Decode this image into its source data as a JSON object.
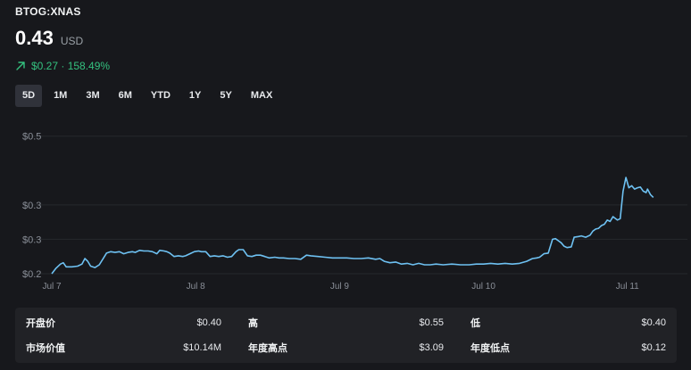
{
  "header": {
    "ticker": "BTOG:XNAS",
    "price": "0.43",
    "currency": "USD",
    "change_text": "$0.27 · 158.49%",
    "change_direction": "up",
    "positive_color": "#34c17f"
  },
  "ranges": {
    "options": [
      "5D",
      "1M",
      "3M",
      "6M",
      "YTD",
      "1Y",
      "5Y",
      "MAX"
    ],
    "selected": "5D"
  },
  "chart_data": {
    "type": "line",
    "line_color": "#6ec1f2",
    "grid": true,
    "legend": "none",
    "x_labels": [
      "Jul 7",
      "Jul 8",
      "Jul 9",
      "Jul 10",
      "Jul 11"
    ],
    "y_ticks": [
      {
        "value": 0.2,
        "label": "$0.2"
      },
      {
        "value": 0.25,
        "label": "$0.3"
      },
      {
        "value": 0.3,
        "label": "$0.3"
      },
      {
        "value": 0.4,
        "label": "$0.5"
      }
    ],
    "ylim": [
      0.2,
      0.41
    ],
    "xlim": [
      0,
      4.2
    ],
    "points": [
      [
        0.0,
        0.2
      ],
      [
        0.03,
        0.208
      ],
      [
        0.06,
        0.214
      ],
      [
        0.08,
        0.216
      ],
      [
        0.1,
        0.21
      ],
      [
        0.14,
        0.21
      ],
      [
        0.18,
        0.211
      ],
      [
        0.21,
        0.214
      ],
      [
        0.23,
        0.222
      ],
      [
        0.25,
        0.218
      ],
      [
        0.27,
        0.211
      ],
      [
        0.3,
        0.209
      ],
      [
        0.33,
        0.213
      ],
      [
        0.36,
        0.223
      ],
      [
        0.38,
        0.23
      ],
      [
        0.41,
        0.232
      ],
      [
        0.44,
        0.231
      ],
      [
        0.47,
        0.232
      ],
      [
        0.5,
        0.229
      ],
      [
        0.53,
        0.231
      ],
      [
        0.56,
        0.232
      ],
      [
        0.58,
        0.231
      ],
      [
        0.61,
        0.234
      ],
      [
        0.64,
        0.233
      ],
      [
        0.67,
        0.233
      ],
      [
        0.7,
        0.232
      ],
      [
        0.73,
        0.229
      ],
      [
        0.75,
        0.234
      ],
      [
        0.78,
        0.233
      ],
      [
        0.8,
        0.232
      ],
      [
        0.82,
        0.23
      ],
      [
        0.85,
        0.225
      ],
      [
        0.88,
        0.226
      ],
      [
        0.91,
        0.225
      ],
      [
        0.93,
        0.226
      ],
      [
        0.96,
        0.229
      ],
      [
        0.99,
        0.232
      ],
      [
        1.02,
        0.233
      ],
      [
        1.04,
        0.232
      ],
      [
        1.07,
        0.232
      ],
      [
        1.1,
        0.225
      ],
      [
        1.13,
        0.226
      ],
      [
        1.16,
        0.225
      ],
      [
        1.19,
        0.226
      ],
      [
        1.22,
        0.224
      ],
      [
        1.25,
        0.225
      ],
      [
        1.28,
        0.232
      ],
      [
        1.3,
        0.235
      ],
      [
        1.33,
        0.235
      ],
      [
        1.36,
        0.226
      ],
      [
        1.39,
        0.225
      ],
      [
        1.42,
        0.227
      ],
      [
        1.45,
        0.227
      ],
      [
        1.48,
        0.225
      ],
      [
        1.51,
        0.223
      ],
      [
        1.55,
        0.224
      ],
      [
        1.58,
        0.223
      ],
      [
        1.61,
        0.223
      ],
      [
        1.65,
        0.222
      ],
      [
        1.69,
        0.222
      ],
      [
        1.73,
        0.221
      ],
      [
        1.77,
        0.227
      ],
      [
        1.8,
        0.226
      ],
      [
        1.85,
        0.225
      ],
      [
        1.9,
        0.224
      ],
      [
        1.95,
        0.223
      ],
      [
        2.0,
        0.223
      ],
      [
        2.05,
        0.223
      ],
      [
        2.1,
        0.222
      ],
      [
        2.15,
        0.222
      ],
      [
        2.2,
        0.223
      ],
      [
        2.25,
        0.221
      ],
      [
        2.28,
        0.222
      ],
      [
        2.31,
        0.218
      ],
      [
        2.35,
        0.216
      ],
      [
        2.39,
        0.217
      ],
      [
        2.43,
        0.214
      ],
      [
        2.47,
        0.215
      ],
      [
        2.51,
        0.213
      ],
      [
        2.55,
        0.215
      ],
      [
        2.59,
        0.213
      ],
      [
        2.63,
        0.213
      ],
      [
        2.67,
        0.214
      ],
      [
        2.72,
        0.213
      ],
      [
        2.78,
        0.214
      ],
      [
        2.84,
        0.213
      ],
      [
        2.9,
        0.213
      ],
      [
        2.95,
        0.214
      ],
      [
        3.0,
        0.214
      ],
      [
        3.05,
        0.215
      ],
      [
        3.1,
        0.214
      ],
      [
        3.15,
        0.215
      ],
      [
        3.2,
        0.214
      ],
      [
        3.25,
        0.215
      ],
      [
        3.3,
        0.218
      ],
      [
        3.34,
        0.222
      ],
      [
        3.37,
        0.223
      ],
      [
        3.39,
        0.224
      ],
      [
        3.42,
        0.229
      ],
      [
        3.45,
        0.23
      ],
      [
        3.48,
        0.25
      ],
      [
        3.5,
        0.251
      ],
      [
        3.52,
        0.248
      ],
      [
        3.54,
        0.245
      ],
      [
        3.56,
        0.24
      ],
      [
        3.58,
        0.238
      ],
      [
        3.61,
        0.239
      ],
      [
        3.63,
        0.253
      ],
      [
        3.66,
        0.254
      ],
      [
        3.68,
        0.255
      ],
      [
        3.71,
        0.253
      ],
      [
        3.74,
        0.256
      ],
      [
        3.76,
        0.262
      ],
      [
        3.78,
        0.265
      ],
      [
        3.8,
        0.266
      ],
      [
        3.82,
        0.27
      ],
      [
        3.84,
        0.272
      ],
      [
        3.86,
        0.278
      ],
      [
        3.88,
        0.276
      ],
      [
        3.9,
        0.283
      ],
      [
        3.93,
        0.278
      ],
      [
        3.95,
        0.28
      ],
      [
        3.97,
        0.32
      ],
      [
        3.99,
        0.34
      ],
      [
        4.01,
        0.325
      ],
      [
        4.03,
        0.328
      ],
      [
        4.05,
        0.323
      ],
      [
        4.07,
        0.325
      ],
      [
        4.09,
        0.326
      ],
      [
        4.11,
        0.32
      ],
      [
        4.13,
        0.318
      ],
      [
        4.14,
        0.323
      ],
      [
        4.16,
        0.315
      ],
      [
        4.18,
        0.311
      ]
    ]
  },
  "stats": [
    {
      "label": "开盘价",
      "value": "$0.40"
    },
    {
      "label": "高",
      "value": "$0.55"
    },
    {
      "label": "低",
      "value": "$0.40"
    },
    {
      "label": "市场价值",
      "value": "$10.14M"
    },
    {
      "label": "年度高点",
      "value": "$3.09"
    },
    {
      "label": "年度低点",
      "value": "$0.12"
    }
  ]
}
